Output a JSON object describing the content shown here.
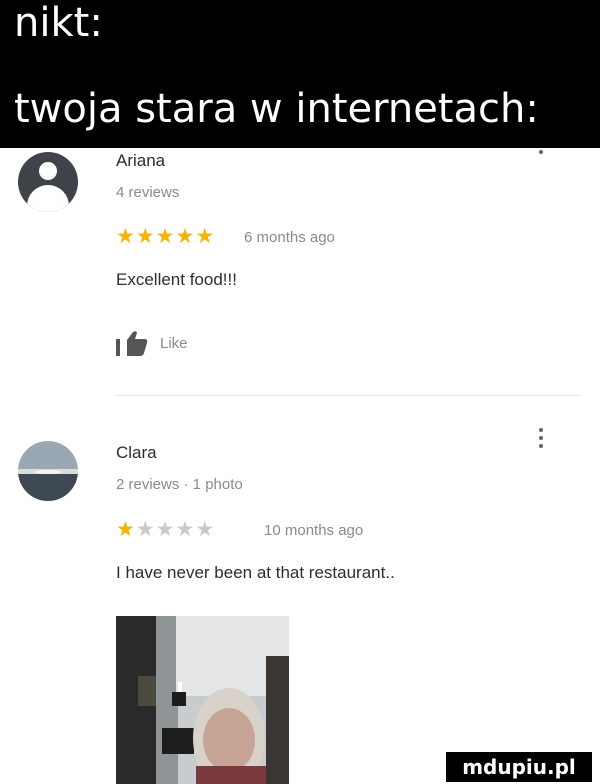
{
  "meme": {
    "line1": "nikt:",
    "line2": "twoja stara w internetach:"
  },
  "reviews": [
    {
      "author": "Ariana",
      "meta": "4 reviews",
      "rating": 5,
      "time": "6 months ago",
      "text": "Excellent food!!!",
      "like_label": "Like"
    },
    {
      "author": "Clara",
      "meta": "2 reviews · 1 photo",
      "rating": 1,
      "time": "10 months ago",
      "text": "I have never been at that restaurant.."
    }
  ],
  "watermark": "mdupiu.pl",
  "colors": {
    "star_filled": "#f4b400",
    "star_empty": "#c9c9c9",
    "header_bg": "#000000"
  }
}
